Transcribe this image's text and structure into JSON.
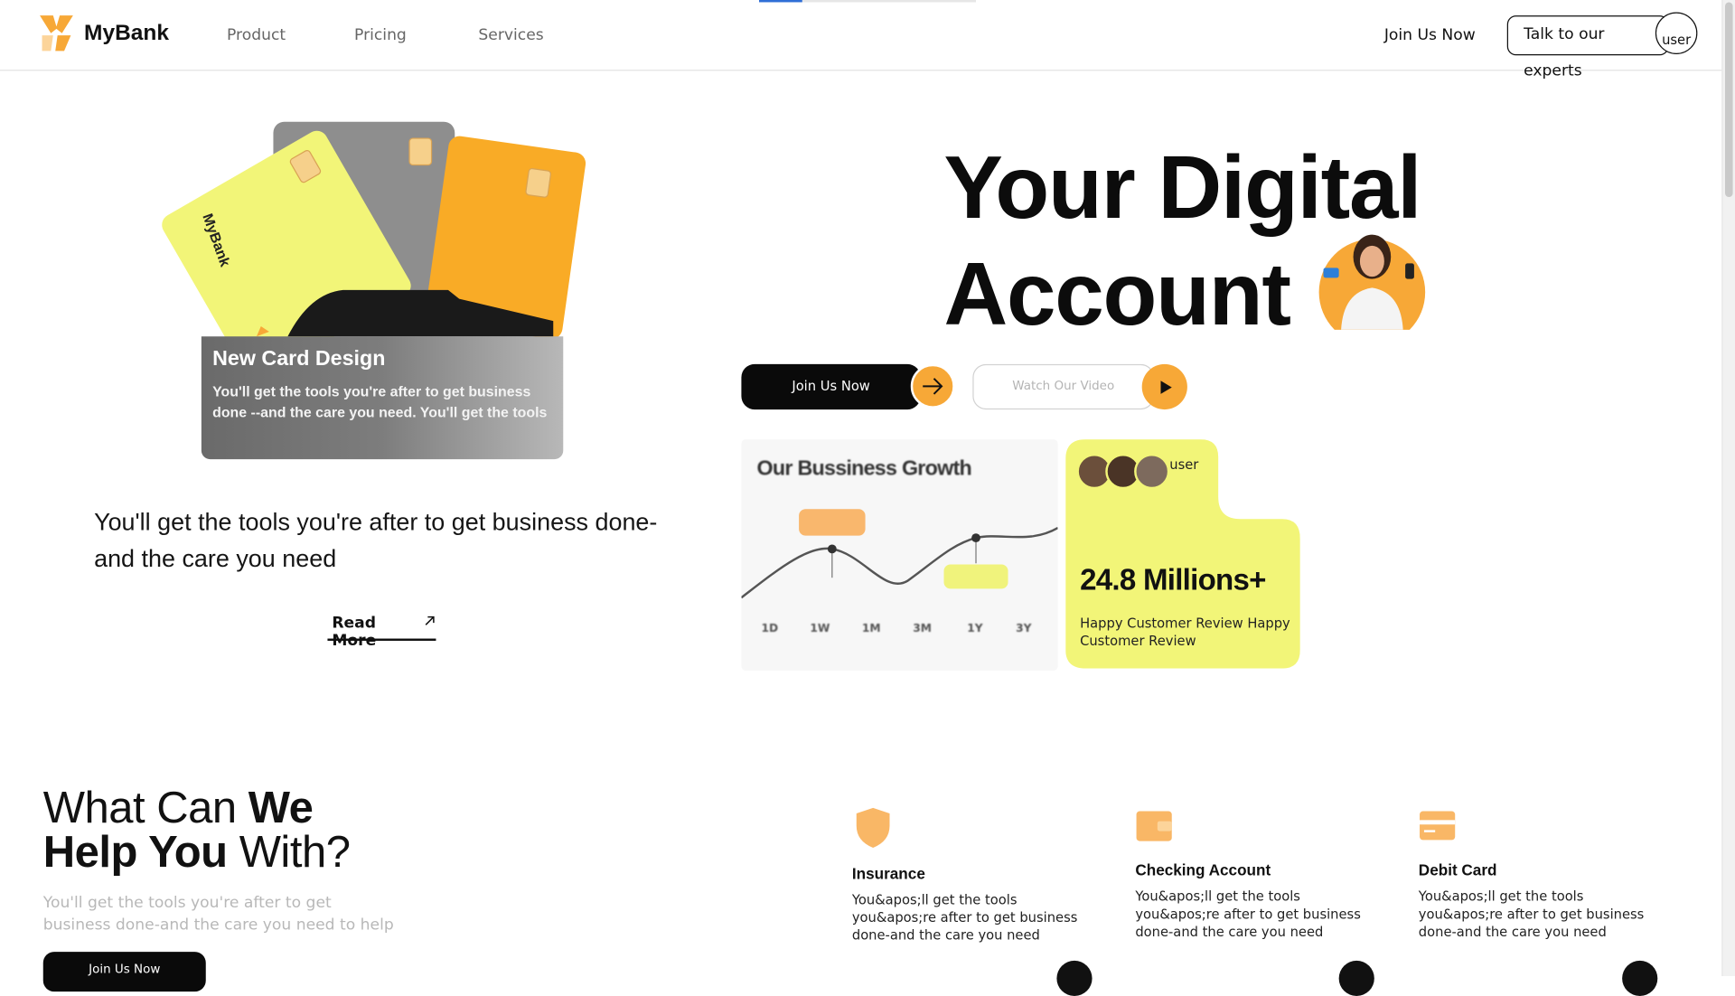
{
  "header": {
    "brand": "MyBank",
    "nav": [
      "Product",
      "Pricing",
      "Services"
    ],
    "join": "Join Us Now",
    "experts": "Talk to our experts",
    "avatar_alt": "user"
  },
  "hero": {
    "card_caption_title": "New Card Design",
    "card_caption_text": "You'll get the tools you're after to get business done --and the care you need. You'll get the tools",
    "card_brand": "MyBank",
    "subtitle": "You'll get the tools you're after to get business done-and the care you need",
    "read_more": "Read More",
    "headline_line1": "Your Digital",
    "headline_line2": "Account",
    "join_btn": "Join Us Now",
    "video_btn": "Watch Our Video"
  },
  "growth": {
    "title": "Our Bussiness Growth",
    "ticks": [
      "1D",
      "1W",
      "1M",
      "3M",
      "1Y",
      "3Y"
    ]
  },
  "stats": {
    "avatar_alt": "user",
    "value": "24.8 Millions+",
    "label": "Happy Customer Review Happy Customer Review"
  },
  "help": {
    "title_a": "What Can ",
    "title_b": "We",
    "title_c": "Help You",
    "title_d": " With?",
    "subtitle": "You'll get the tools you're after to get business done-and the care you need to help",
    "join_btn": "Join Us Now",
    "services": [
      {
        "title": "Insurance",
        "text": "You&apos;ll get the tools you&apos;re after to get business done-and the care you need",
        "icon": "shield-icon"
      },
      {
        "title": "Checking Account",
        "text": "You&apos;ll get the tools you&apos;re after to get business done-and the care you need",
        "icon": "wallet-icon"
      },
      {
        "title": "Debit Card",
        "text": "You&apos;ll get the tools you&apos;re after to get business done-and the care you need",
        "icon": "card-icon"
      }
    ]
  },
  "colors": {
    "accent_orange": "#f7a837",
    "accent_yellow": "#f2f578",
    "dark": "#0a0a0a"
  }
}
